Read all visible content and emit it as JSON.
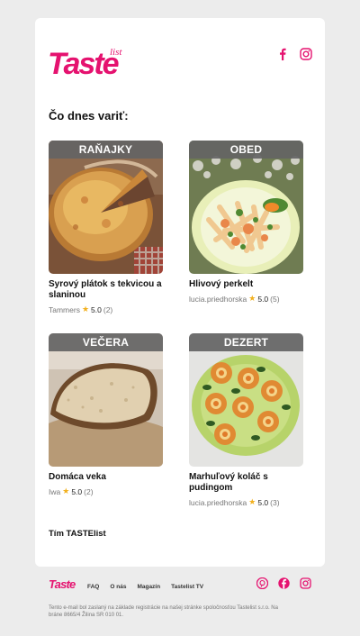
{
  "brand": {
    "logo_text": "Taste",
    "logo_suffix": "list",
    "accent": "#e5126f"
  },
  "heading": "Čo dnes variť:",
  "recipes": [
    {
      "category": "RAŇAJKY",
      "title": "Syrový plátok s tekvicou a slaninou",
      "author": "Tammers",
      "rating": "5.0",
      "count": "(2)",
      "image": "quiche"
    },
    {
      "category": "OBED",
      "title": "Hlivový perkelt",
      "author": "lucia.priedhorska",
      "rating": "5.0",
      "count": "(5)",
      "image": "pasta-plate"
    },
    {
      "category": "VEČERA",
      "title": "Domáca veka",
      "author": "Iwa",
      "rating": "5.0",
      "count": "(2)",
      "image": "bread"
    },
    {
      "category": "DEZERT",
      "title": "Marhuľový koláč s pudingom",
      "author": "lucia.priedhorska",
      "rating": "5.0",
      "count": "(3)",
      "image": "tartlets"
    }
  ],
  "signature": "Tím TASTElist",
  "footer": {
    "nav": [
      "FAQ",
      "O nás",
      "Magazín",
      "Tastelist TV"
    ],
    "note": "Tento e-mail bol zaslaný na základe registrácie na našej stránke spoločnosťou Tastelist s.r.o. Na bráne 8665/4 Žilina SR 010 01."
  },
  "icons": {
    "facebook": "facebook-icon",
    "instagram": "instagram-icon",
    "pinterest": "pinterest-icon",
    "star": "star-icon"
  }
}
